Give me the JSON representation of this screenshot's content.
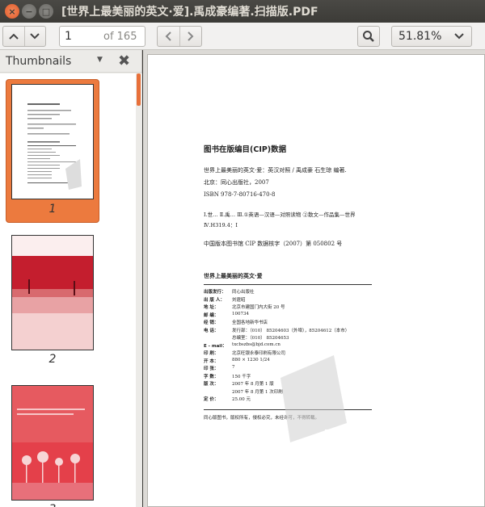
{
  "window": {
    "title": "[世界上最美丽的英文·爱].禹成豪编著.扫描版.PDF",
    "close_glyph": "×",
    "minimize_glyph": "−",
    "maximize_glyph": "□"
  },
  "toolbar": {
    "current_page": "1",
    "page_of": "of 165",
    "zoom": "51.81%"
  },
  "sidebar": {
    "label": "Thumbnails",
    "dropdown_glyph": "▼",
    "close_glyph": "✖",
    "thumbnails": [
      {
        "label": "1",
        "selected": true
      },
      {
        "label": "2",
        "selected": false
      },
      {
        "label": "3",
        "selected": false
      }
    ]
  },
  "page": {
    "cip_title": "图书在版编目(CIP)数据",
    "cip_line1": "世界上最美丽的英文·爱：英汉对照 / 禹成豪  石生琼  编著.",
    "cip_line2": "北京：同心出版社，2007",
    "cip_line3": "ISBN 978-7-80716-470-8",
    "cip_line4": "Ⅰ.世…  Ⅱ.禹…  Ⅲ.①英语—汉语—对照读物 ②散文—作品集—世界",
    "cip_line5": "Ⅳ.H319.4：Ⅰ",
    "cip_number": "中国版本图书馆 CIP 数据核字（2007）第 050802 号",
    "book_title": "世界上最美丽的英文·爱",
    "info_rows": [
      {
        "k": "出版发行：",
        "v": "同心出版社"
      },
      {
        "k": "出 版 人：",
        "v": "刘霆昭"
      },
      {
        "k": "地    址：",
        "v": "北京市建国门内大街 20 号"
      },
      {
        "k": "邮    编：",
        "v": "100734"
      },
      {
        "k": "经    销：",
        "v": "全国各地新华书店"
      },
      {
        "k": "电    话：",
        "v": "发行部：（010） 85204603（外埠），85204612（本市）"
      },
      {
        "k": "",
        "v": "总编室：（010） 85204653"
      },
      {
        "k": "E - mail：",
        "v": "txcbszbs@bjd.com.cn"
      },
      {
        "k": "印    刷：",
        "v": "北京旺银永泰印刷有限公司"
      },
      {
        "k": "开    本：",
        "v": "880 × 1230    1/24"
      },
      {
        "k": "印    张：",
        "v": "7"
      },
      {
        "k": "字    数：",
        "v": "150 千字"
      },
      {
        "k": "版    次：",
        "v": "2007 年 8 月第 1 版"
      },
      {
        "k": "",
        "v": "2007 年 8 月第 1 次印刷"
      },
      {
        "k": "定    价：",
        "v": "25.00 元"
      }
    ],
    "footer_note": "同心版图书，版权所有，侵权必究，未经许可，不得转载。",
    "watermark": "PDG"
  },
  "colors": {
    "accent": "#ec7a3e",
    "titlebar": "#3c3b37",
    "toolbar": "#f2f1f0"
  },
  "icons": [
    "close-icon",
    "minimize-icon",
    "maximize-icon",
    "chevron-up-icon",
    "chevron-down-icon",
    "chevron-left-icon",
    "chevron-right-icon",
    "search-icon",
    "dropdown-arrow-icon"
  ]
}
